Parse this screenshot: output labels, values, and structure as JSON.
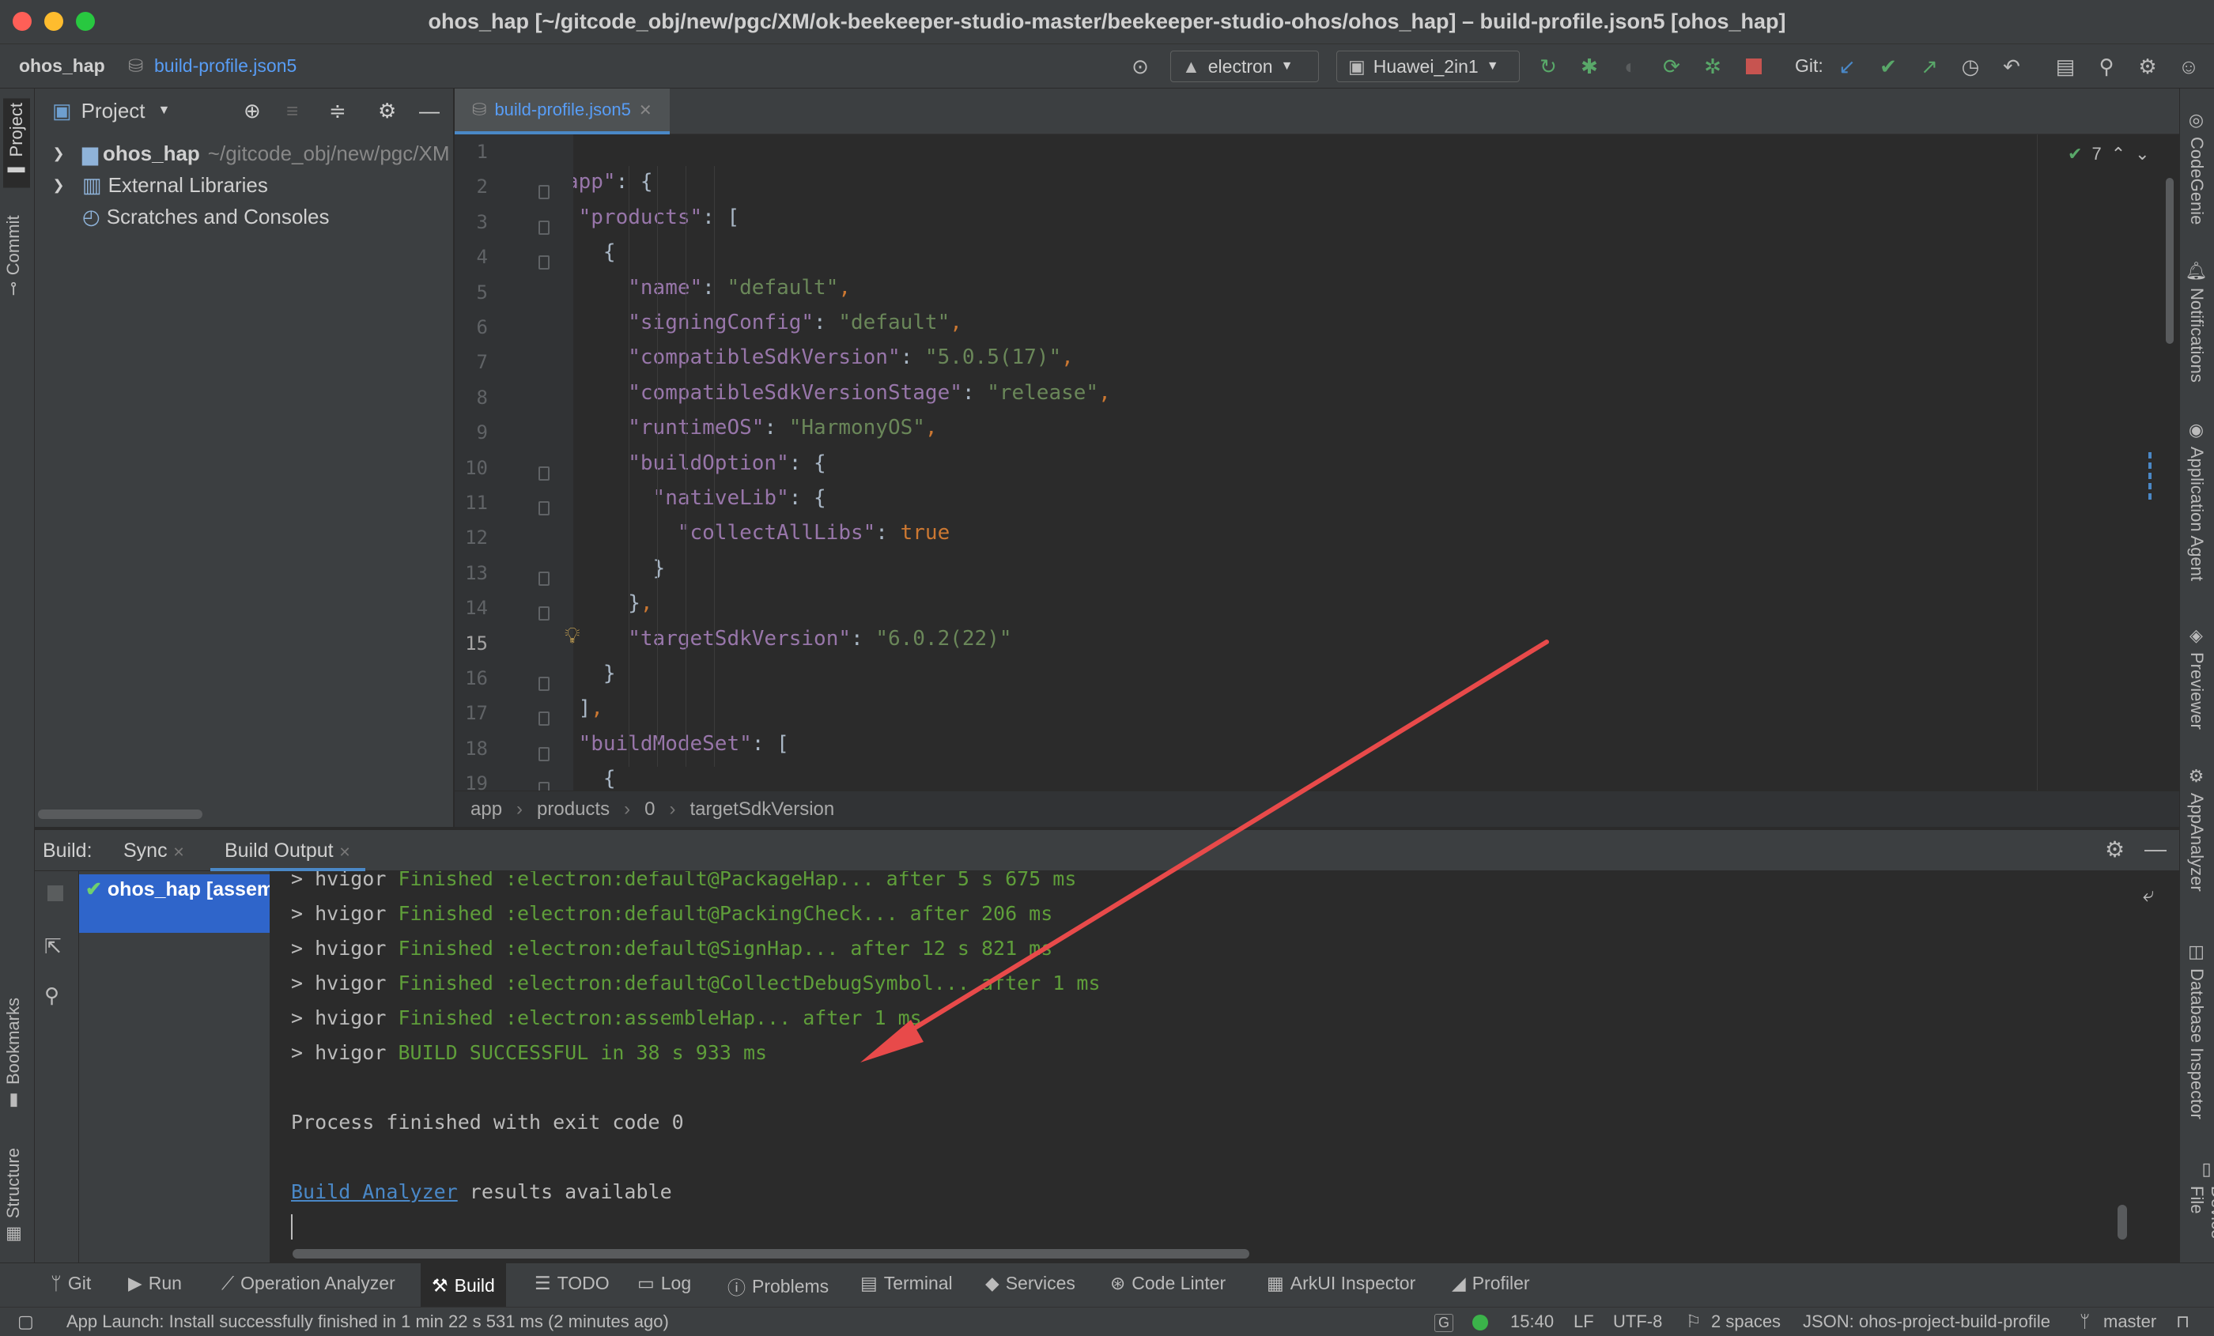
{
  "window": {
    "title": "ohos_hap [~/gitcode_obj/new/pgc/XM/ok-beekeeper-studio-master/beekeeper-studio-ohos/ohos_hap] – build-profile.json5 [ohos_hap]"
  },
  "nav": {
    "project": "ohos_hap",
    "file": "build-profile.json5",
    "module_combo": "electron",
    "device_combo": "Huawei_2in1",
    "git_label": "Git:"
  },
  "left_tabs": {
    "project": "Project",
    "commit": "Commit",
    "bookmarks": "Bookmarks",
    "structure": "Structure"
  },
  "right_tabs": [
    "CodeGenie",
    "Notifications",
    "Application Agent",
    "Previewer",
    "AppAnalyzer",
    "Database Inspector",
    "Device File"
  ],
  "project_panel": {
    "title": "Project",
    "items": [
      {
        "label": "ohos_hap",
        "path": "~/gitcode_obj/new/pgc/XM"
      },
      {
        "label": "External Libraries"
      },
      {
        "label": "Scratches and Consoles"
      }
    ]
  },
  "editor": {
    "tab": "build-profile.json5",
    "problems_count": "7",
    "current_line": "15",
    "lines": [
      {
        "n": "1",
        "html": "<span class='w'>{</span>"
      },
      {
        "n": "2",
        "html": "  <span class='k'>\"app\"</span><span class='w'>: {</span>"
      },
      {
        "n": "3",
        "html": "    <span class='k'>\"products\"</span><span class='w'>: [</span>"
      },
      {
        "n": "4",
        "html": "      <span class='w'>{</span>"
      },
      {
        "n": "5",
        "html": "        <span class='k'>\"name\"</span><span class='w'>: </span><span class='s'>\"default\"</span><span class='p'>,</span>"
      },
      {
        "n": "6",
        "html": "        <span class='k'>\"signingConfig\"</span><span class='w'>: </span><span class='s'>\"default\"</span><span class='p'>,</span>"
      },
      {
        "n": "7",
        "html": "        <span class='k'>\"compatibleSdkVersion\"</span><span class='w'>: </span><span class='s'>\"5.0.5(17)\"</span><span class='p'>,</span>"
      },
      {
        "n": "8",
        "html": "        <span class='k'>\"compatibleSdkVersionStage\"</span><span class='w'>: </span><span class='s'>\"release\"</span><span class='p'>,</span>"
      },
      {
        "n": "9",
        "html": "        <span class='k'>\"runtimeOS\"</span><span class='w'>: </span><span class='s'>\"HarmonyOS\"</span><span class='p'>,</span>"
      },
      {
        "n": "10",
        "html": "        <span class='k'>\"buildOption\"</span><span class='w'>: {</span>"
      },
      {
        "n": "11",
        "html": "          <span class='k'>\"nativeLib\"</span><span class='w'>: {</span>"
      },
      {
        "n": "12",
        "html": "            <span class='k'>\"collectAllLibs\"</span><span class='w'>: </span><span class='p'>true</span>"
      },
      {
        "n": "13",
        "html": "          <span class='w'>}</span>"
      },
      {
        "n": "14",
        "html": "        <span class='w'>}</span><span class='p'>,</span>"
      },
      {
        "n": "15",
        "html": "        <span class='k'>\"targetSdkVersion\"</span><span class='w'>: </span><span class='s'>\"6.0.2(22)\"</span>"
      },
      {
        "n": "16",
        "html": "      <span class='w'>}</span>"
      },
      {
        "n": "17",
        "html": "    <span class='w'>]</span><span class='p'>,</span>"
      },
      {
        "n": "18",
        "html": "    <span class='k'>\"buildModeSet\"</span><span class='w'>: [</span>"
      },
      {
        "n": "19",
        "html": "      <span class='w'>{</span>"
      }
    ],
    "breadcrumb": [
      "app",
      "products",
      "0",
      "targetSdkVersion"
    ]
  },
  "build": {
    "label": "Build:",
    "tabs": [
      "Sync",
      "Build Output"
    ],
    "tree_item": "ohos_hap [assem",
    "output": [
      {
        "prefix": "> hvigor ",
        "text": "Finished :electron:default@PackageHap... after 5 s 675 ms"
      },
      {
        "prefix": "> hvigor ",
        "text": "Finished :electron:default@PackingCheck... after 206 ms"
      },
      {
        "prefix": "> hvigor ",
        "text": "Finished :electron:default@SignHap... after 12 s 821 ms"
      },
      {
        "prefix": "> hvigor ",
        "text": "Finished :electron:default@CollectDebugSymbol... after 1 ms"
      },
      {
        "prefix": "> hvigor ",
        "text": "Finished :electron:assembleHap... after 1 ms"
      },
      {
        "prefix": "> hvigor ",
        "text": "BUILD SUCCESSFUL in 38 s 933 ms"
      }
    ],
    "exit_line": "Process finished with exit code 0",
    "analyzer_link": "Build Analyzer",
    "analyzer_rest": " results available"
  },
  "tool_windows": [
    "Git",
    "Run",
    "Operation Analyzer",
    "Build",
    "TODO",
    "Log",
    "Problems",
    "Terminal",
    "Services",
    "Code Linter",
    "ArkUI Inspector",
    "Profiler"
  ],
  "status": {
    "message": "App Launch: Install successfully finished in 1 min 22 s 531 ms (2 minutes ago)",
    "time": "15:40",
    "line_sep": "LF",
    "encoding": "UTF-8",
    "indent": "2 spaces",
    "schema": "JSON: ohos-project-build-profile",
    "branch": "master"
  },
  "colors": {
    "accent": "#4a88c7",
    "success": "#5f9e3a",
    "arrow": "#e84a4a",
    "stop": "#c75450"
  }
}
